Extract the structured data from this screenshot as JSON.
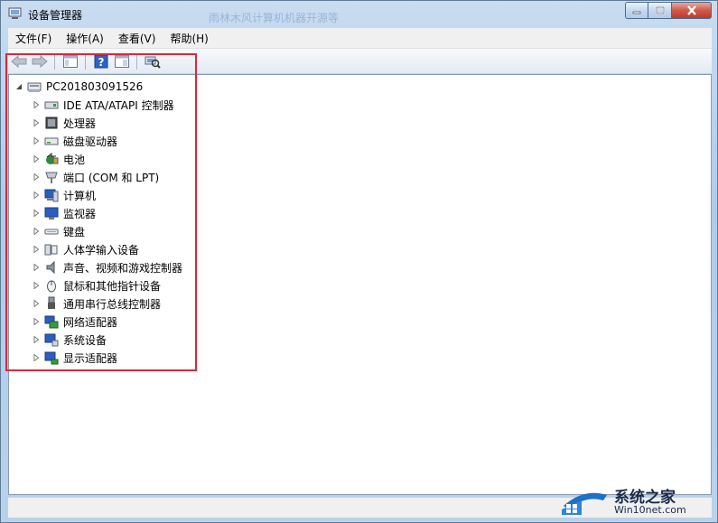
{
  "window": {
    "title": "设备管理器",
    "background_title": "雨林木风计算机机器开源等"
  },
  "menu": {
    "items": [
      "文件(F)",
      "操作(A)",
      "查看(V)",
      "帮助(H)"
    ]
  },
  "toolbar": {
    "icons": [
      "back-arrow-icon",
      "forward-arrow-icon",
      "console-tree-icon",
      "help-icon",
      "properties-icon",
      "scan-hardware-icon"
    ]
  },
  "tree": {
    "root": "PC201803091526",
    "items": [
      {
        "label": "IDE ATA/ATAPI 控制器",
        "icon": "ide-controller-icon"
      },
      {
        "label": "处理器",
        "icon": "processor-icon"
      },
      {
        "label": "磁盘驱动器",
        "icon": "disk-drive-icon"
      },
      {
        "label": "电池",
        "icon": "battery-icon"
      },
      {
        "label": "端口 (COM 和 LPT)",
        "icon": "port-icon"
      },
      {
        "label": "计算机",
        "icon": "computer-icon"
      },
      {
        "label": "监视器",
        "icon": "monitor-icon"
      },
      {
        "label": "键盘",
        "icon": "keyboard-icon"
      },
      {
        "label": "人体学输入设备",
        "icon": "hid-icon"
      },
      {
        "label": "声音、视频和游戏控制器",
        "icon": "speaker-icon"
      },
      {
        "label": "鼠标和其他指针设备",
        "icon": "mouse-icon"
      },
      {
        "label": "通用串行总线控制器",
        "icon": "usb-icon"
      },
      {
        "label": "网络适配器",
        "icon": "network-adapter-icon"
      },
      {
        "label": "系统设备",
        "icon": "system-device-icon"
      },
      {
        "label": "显示适配器",
        "icon": "display-adapter-icon"
      }
    ]
  },
  "watermark": {
    "line1": "系统之家",
    "line2": "Win10net.com"
  },
  "colors": {
    "highlight": "#e0253a",
    "accent": "#1f6fc4"
  }
}
